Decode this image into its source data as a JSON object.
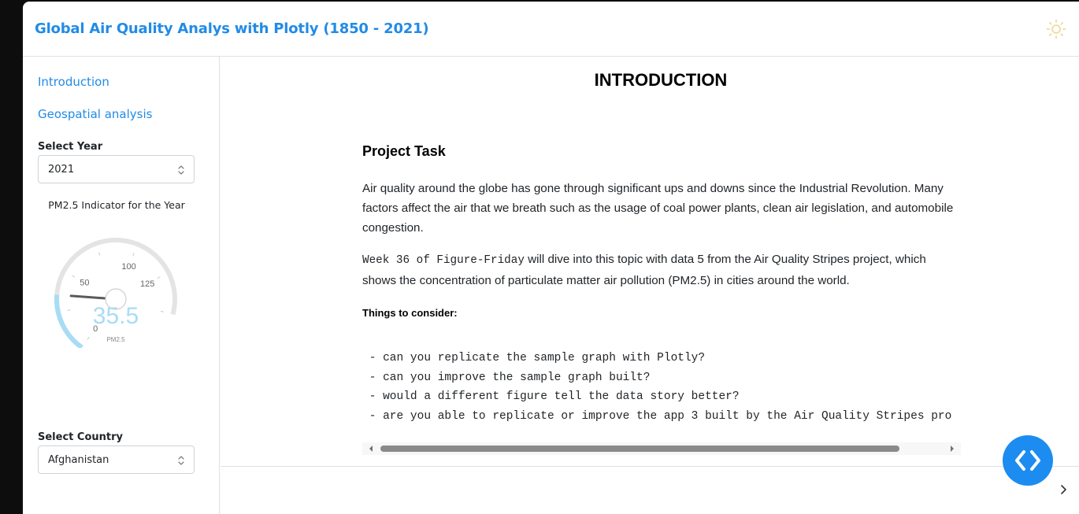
{
  "header": {
    "title": "Global Air Quality Analys with Plotly (1850 - 2021)",
    "theme_icon": "sun-icon"
  },
  "sidebar": {
    "nav": [
      {
        "label": "Introduction"
      },
      {
        "label": "Geospatial analysis"
      }
    ],
    "year": {
      "label": "Select Year",
      "value": "2021"
    },
    "gauge": {
      "title": "PM2.5 Indicator for the Year",
      "value": "35.5",
      "numeric_value": 35.5,
      "unit": "PM2.5",
      "ticks": [
        "0",
        "50",
        "100",
        "125"
      ],
      "colors": {
        "fill": "#a8dcf5",
        "track": "#e4e4e4",
        "needle": "#5a5a5a",
        "number": "#a8dcf5"
      }
    },
    "country": {
      "label": "Select Country",
      "value": "Afghanistan"
    }
  },
  "main": {
    "heading": "INTRODUCTION",
    "section_title": "Project Task",
    "paragraph1": "Air quality around the globe has gone through significant ups and downs since the Industrial Revolution. Many factors affect the air that we breath such as the usage of coal power plants, clean air legislation, and automobile congestion.",
    "paragraph2_code": "Week 36 of Figure-Friday",
    "paragraph2_text": " will dive into this topic with data 5 from the Air Quality Stripes project, which shows the concentration of particulate matter air pollution (PM2.5) in cities around the world.",
    "considerations_label": "Things to consider:",
    "code_lines": [
      " - can you replicate the sample graph with Plotly?",
      " - can you improve the sample graph built?",
      " - would a different figure tell the data story better?",
      " - are you able to replicate or improve the app 3 built by the Air Quality Stripes pro"
    ]
  },
  "footer": {
    "toggle_icon": "chevron-right-icon"
  },
  "fab": {
    "icon": "code-brackets-icon",
    "color": "#1c8cf0"
  }
}
